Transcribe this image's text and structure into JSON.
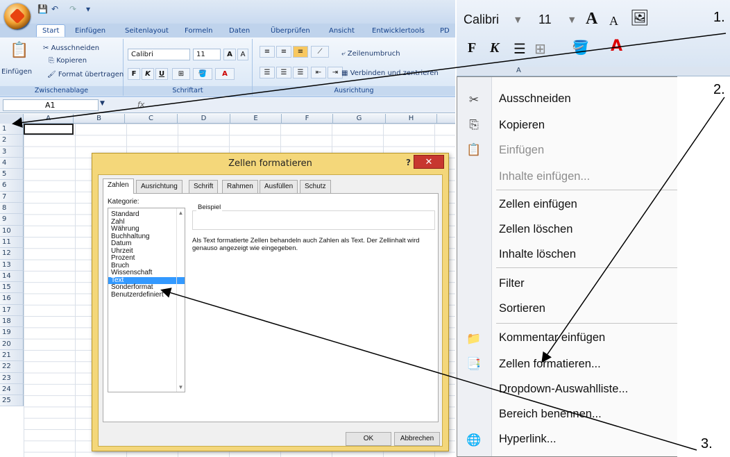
{
  "excel": {
    "tabs": [
      "Start",
      "Einfügen",
      "Seitenlayout",
      "Formeln",
      "Daten",
      "Überprüfen",
      "Ansicht",
      "Entwicklertools",
      "PD"
    ],
    "clipboard": {
      "paste": "Einfügen",
      "cut": "Ausschneiden",
      "copy": "Kopieren",
      "format_painter": "Format übertragen",
      "group": "Zwischenablage"
    },
    "font": {
      "name": "Calibri",
      "size": "11",
      "bold": "F",
      "italic": "K",
      "underline": "U",
      "group": "Schriftart"
    },
    "alignment": {
      "wrap": "Zeilenumbruch",
      "merge": "Verbinden und zentrieren",
      "group": "Ausrichtung"
    },
    "name_box": "A1",
    "fx": "fx",
    "columns": [
      "A",
      "B",
      "C",
      "D",
      "E",
      "F",
      "G",
      "H"
    ],
    "rows": [
      "1",
      "2",
      "3",
      "4",
      "5",
      "6",
      "7",
      "8",
      "9",
      "10",
      "11",
      "12",
      "13",
      "14",
      "15",
      "16",
      "17",
      "18",
      "19",
      "20",
      "21",
      "22",
      "23",
      "24",
      "25"
    ]
  },
  "dialog": {
    "title": "Zellen formatieren",
    "help": "?",
    "close": "✕",
    "tabs": [
      "Zahlen",
      "Ausrichtung",
      "Schrift",
      "Rahmen",
      "Ausfüllen",
      "Schutz"
    ],
    "category_label": "Kategorie:",
    "categories": [
      "Standard",
      "Zahl",
      "Währung",
      "Buchhaltung",
      "Datum",
      "Uhrzeit",
      "Prozent",
      "Bruch",
      "Wissenschaft",
      "Text",
      "Sonderformat",
      "Benutzerdefiniert"
    ],
    "selected_category": "Text",
    "sample_label": "Beispiel",
    "description": "Als Text formatierte Zellen behandeln auch Zahlen als Text. Der Zellinhalt wird genauso angezeigt wie eingegeben.",
    "ok": "OK",
    "cancel": "Abbrechen"
  },
  "mini_toolbar": {
    "font": "Calibri",
    "size": "11",
    "grow": "A",
    "shrink": "A",
    "bold": "F",
    "italic": "K",
    "column_header": "A"
  },
  "context_menu": [
    {
      "label": "Ausschneiden",
      "disabled": false,
      "icon": "scissors-icon"
    },
    {
      "label": "Kopieren",
      "disabled": false,
      "icon": "copy-icon"
    },
    {
      "label": "Einfügen",
      "disabled": true,
      "icon": "paste-icon"
    },
    {
      "label": "Inhalte einfügen...",
      "disabled": true,
      "icon": ""
    },
    {
      "label": "Zellen einfügen",
      "disabled": false,
      "icon": ""
    },
    {
      "label": "Zellen löschen",
      "disabled": false,
      "icon": ""
    },
    {
      "label": "Inhalte löschen",
      "disabled": false,
      "icon": ""
    },
    {
      "label": "Filter",
      "disabled": false,
      "icon": ""
    },
    {
      "label": "Sortieren",
      "disabled": false,
      "icon": ""
    },
    {
      "label": "Kommentar einfügen",
      "disabled": false,
      "icon": "comment-icon"
    },
    {
      "label": "Zellen formatieren...",
      "disabled": false,
      "icon": "format-cells-icon"
    },
    {
      "label": "Dropdown-Auswahlliste...",
      "disabled": false,
      "icon": ""
    },
    {
      "label": "Bereich benennen...",
      "disabled": false,
      "icon": ""
    },
    {
      "label": "Hyperlink...",
      "disabled": false,
      "icon": "hyperlink-icon"
    }
  ],
  "step_labels": [
    "1.",
    "2.",
    "3."
  ],
  "colors": {
    "arrow": "#000000",
    "selection": "#3399ff",
    "close": "#c7372f"
  }
}
